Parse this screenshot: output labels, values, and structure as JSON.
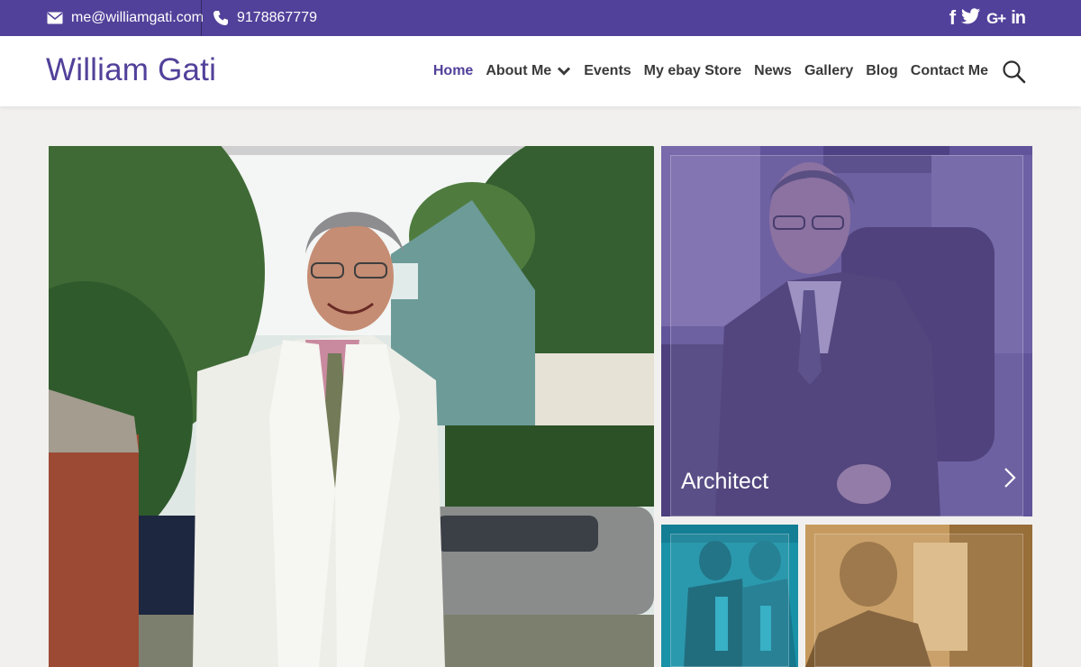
{
  "topbar": {
    "email": "me@williamgati.com",
    "phone": "9178867779",
    "socials": [
      {
        "name": "facebook",
        "glyph": "f"
      },
      {
        "name": "twitter",
        "glyph": "twitter-bird"
      },
      {
        "name": "google-plus",
        "glyph": "G+"
      },
      {
        "name": "linkedin",
        "glyph": "in"
      }
    ]
  },
  "header": {
    "logo": "William Gati",
    "nav": [
      {
        "label": "Home",
        "active": true
      },
      {
        "label": "About Me",
        "has_dropdown": true
      },
      {
        "label": "Events"
      },
      {
        "label": "My ebay Store"
      },
      {
        "label": "News"
      },
      {
        "label": "Gallery"
      },
      {
        "label": "Blog"
      },
      {
        "label": "Contact Me"
      }
    ]
  },
  "tiles": {
    "main": {
      "alt": "William Gati in white jacket outdoors"
    },
    "architect": {
      "label": "Architect",
      "tint": "#52419a"
    },
    "music": {
      "tint": "#1796ad"
    },
    "piano": {
      "tint": "#c69a5e"
    }
  },
  "colors": {
    "brand": "#52419a",
    "background": "#f1f0ee"
  }
}
